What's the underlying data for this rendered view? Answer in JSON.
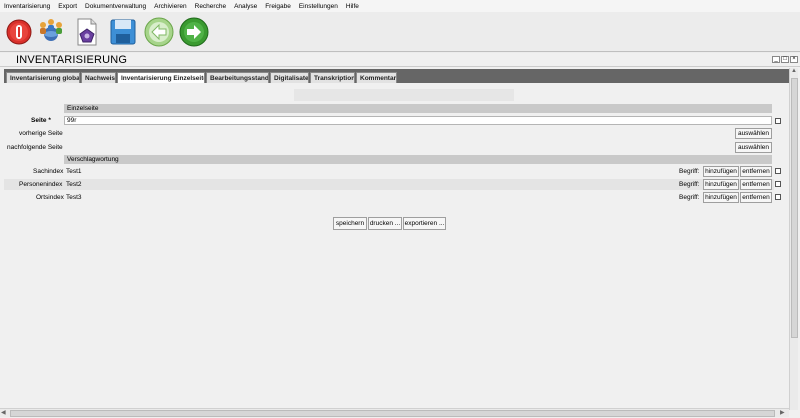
{
  "menu": [
    "Inventarisierung",
    "Export",
    "Dokumentverwaltung",
    "Archivieren",
    "Recherche",
    "Analyse",
    "Freigabe",
    "Einstellungen",
    "Hilfe"
  ],
  "toolbar": {
    "icons": [
      "power-icon",
      "people-network-icon",
      "document-stamp-icon",
      "save-icon",
      "back-arrow-icon",
      "forward-arrow-icon"
    ],
    "colors": {
      "power": "#d9302a",
      "save": "#3d8fd6",
      "arrow": "#5aa63a"
    }
  },
  "window": {
    "title": "INVENTARISIERUNG"
  },
  "tabs": [
    "Inventarisierung global",
    "Nachweis",
    "Inventarisierung Einzelseite",
    "Bearbeitungsstand",
    "Digitalisate",
    "Transkription",
    "Kommentar"
  ],
  "form": {
    "einzelseite_header": "Einzelseite",
    "seite_label": "Seite *",
    "seite_value": "99r",
    "vorherige_label": "vorherige Seite",
    "nachfolgende_label": "nachfolgende Seite",
    "auswaehlen": "auswählen",
    "verschlag_header": "Verschlagwortung",
    "begriff_label": "Begriff:",
    "hinzufuegen": "hinzufügen",
    "entfernen": "entfernen",
    "index": [
      {
        "label": "Sachindex",
        "value": "Test1"
      },
      {
        "label": "Personenindex",
        "value": "Test2"
      },
      {
        "label": "Ortsindex",
        "value": "Test3"
      }
    ]
  },
  "actions": {
    "save": "speichern",
    "print": "drucken ...",
    "export": "exportieren ..."
  }
}
